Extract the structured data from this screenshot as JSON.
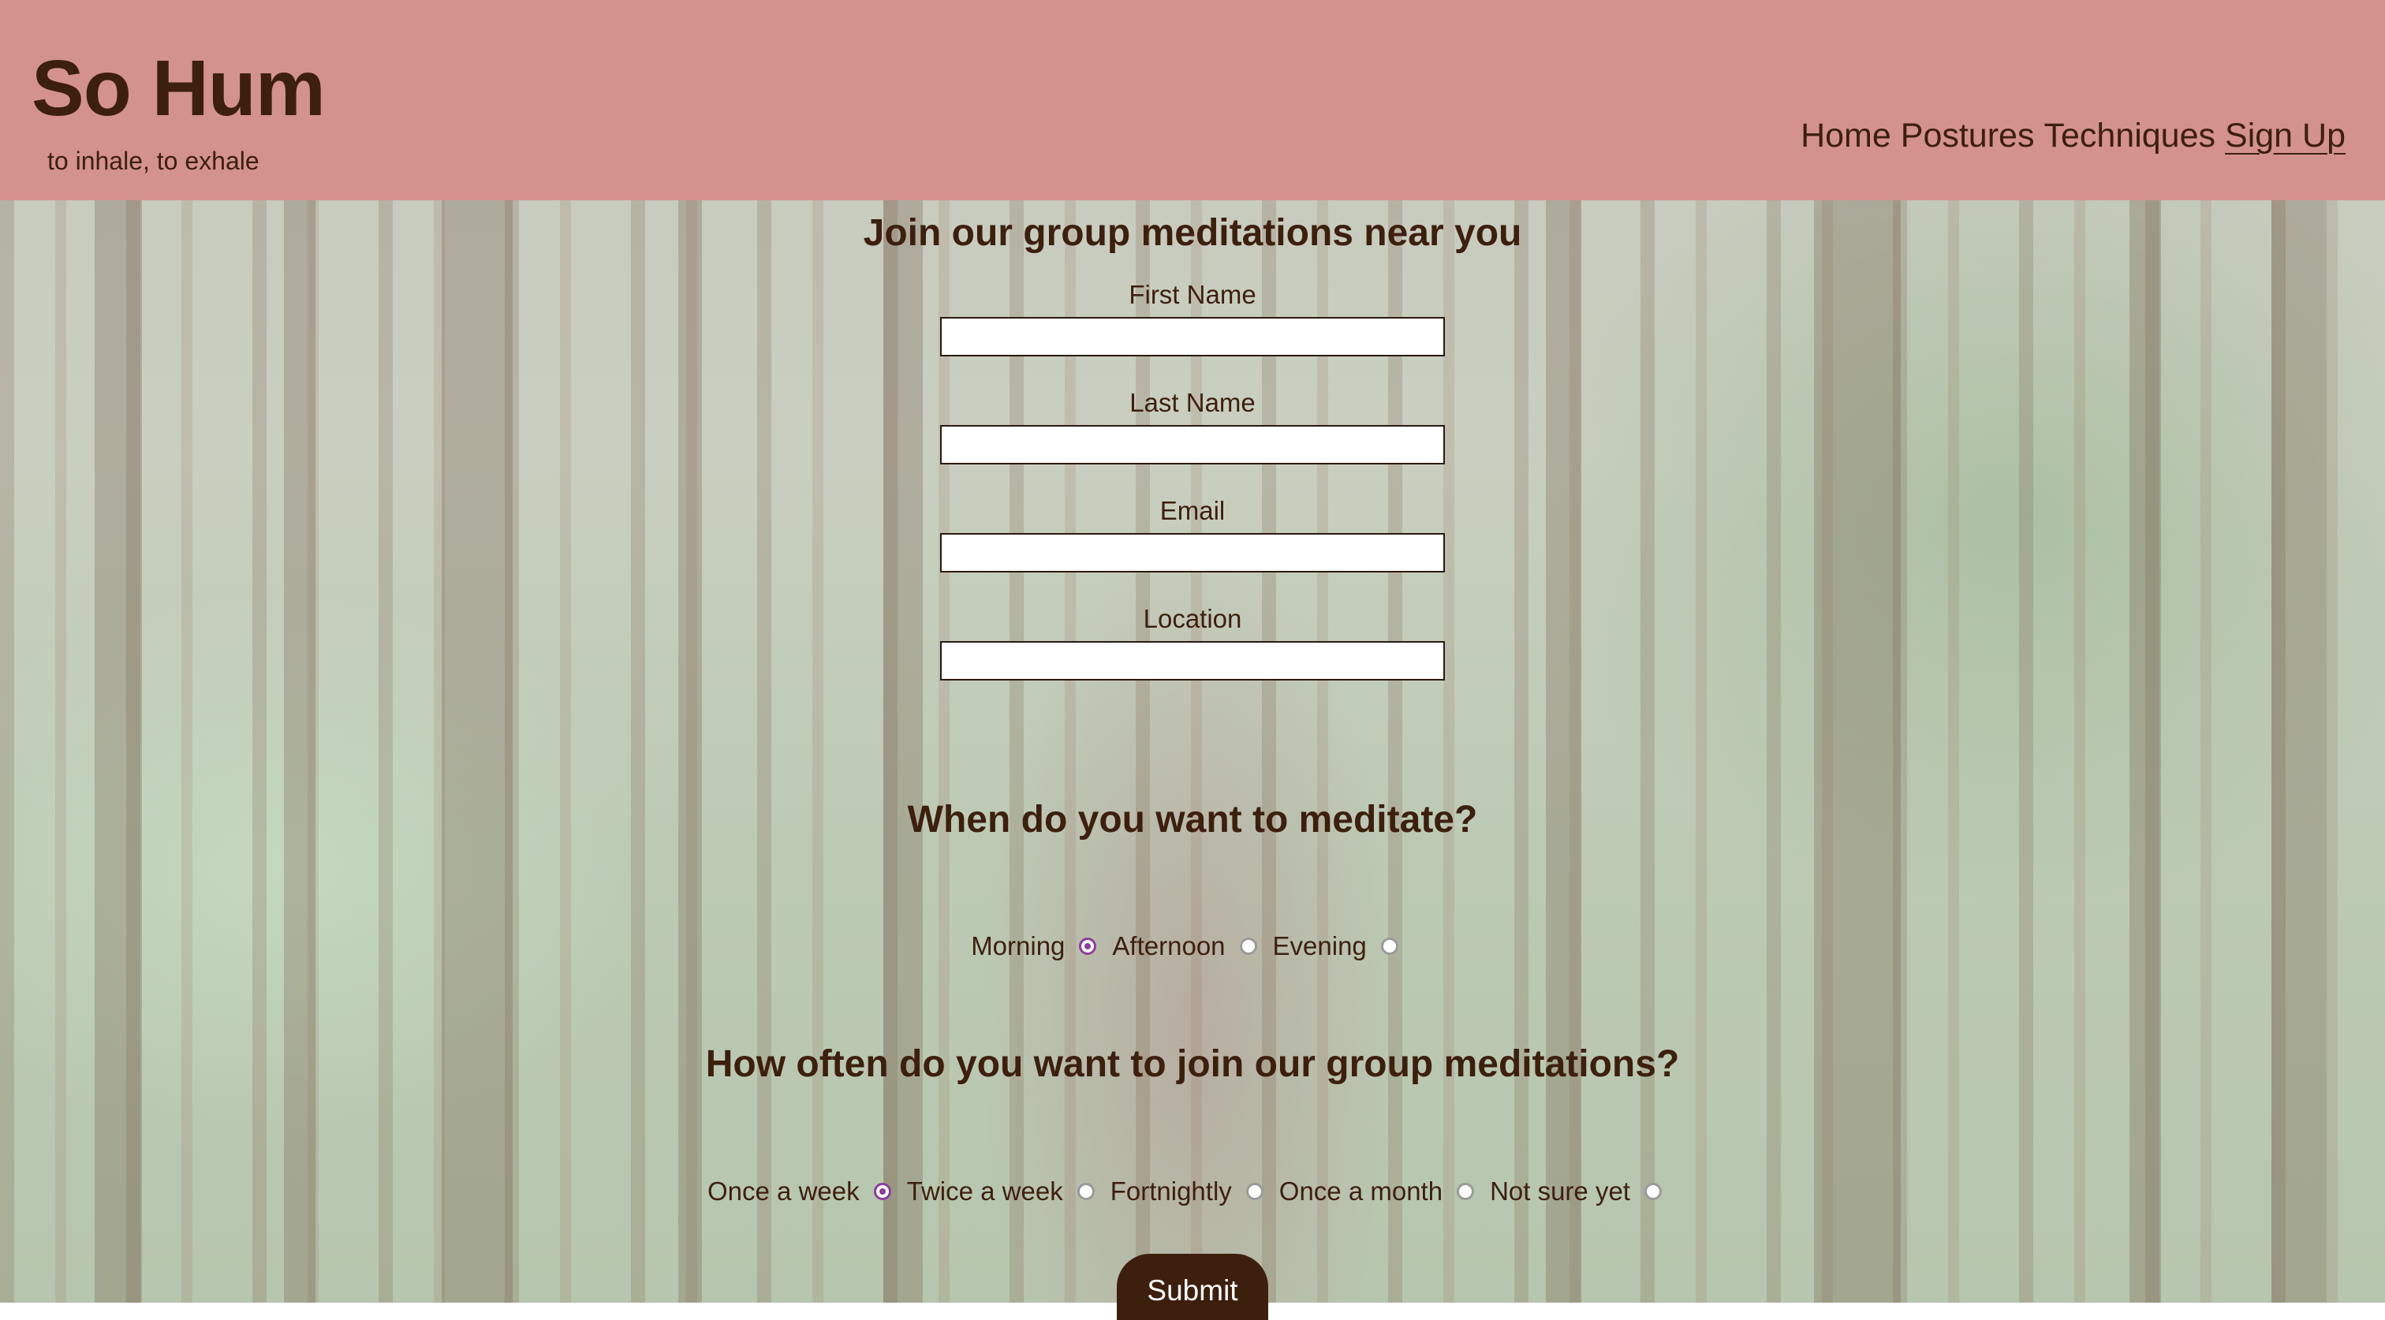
{
  "header": {
    "title": "So Hum",
    "tagline": "to inhale, to exhale",
    "nav": [
      {
        "label": "Home"
      },
      {
        "label": "Postures"
      },
      {
        "label": "Techniques"
      },
      {
        "label": "Sign Up",
        "active": true
      }
    ]
  },
  "form": {
    "heading": "Join our group meditations near you",
    "fields": [
      {
        "label": "First Name",
        "value": ""
      },
      {
        "label": "Last Name",
        "value": ""
      },
      {
        "label": "Email",
        "value": ""
      },
      {
        "label": "Location",
        "value": ""
      }
    ],
    "time_question": "When do you want to meditate?",
    "time_options": [
      {
        "label": "Morning",
        "checked": true
      },
      {
        "label": "Afternoon",
        "checked": false
      },
      {
        "label": "Evening",
        "checked": false
      }
    ],
    "frequency_question": "How often do you want to join our group meditations?",
    "frequency_options": [
      {
        "label": "Once a week",
        "checked": true
      },
      {
        "label": "Twice a week",
        "checked": false
      },
      {
        "label": "Fortnightly",
        "checked": false
      },
      {
        "label": "Once a month",
        "checked": false
      },
      {
        "label": "Not sure yet",
        "checked": false
      }
    ],
    "submit_label": "Submit"
  },
  "colors": {
    "header_bg": "#d4928d",
    "text": "#3d1f0e",
    "radio_selected": "#8b3f9c",
    "submit_bg": "#3d1f0e"
  }
}
